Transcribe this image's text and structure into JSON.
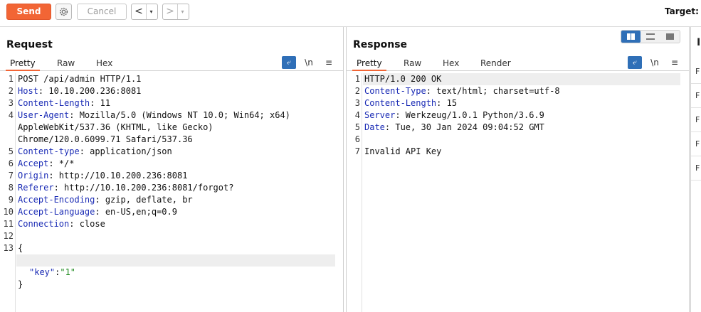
{
  "toolbar": {
    "send_label": "Send",
    "cancel_label": "Cancel",
    "back_arrow": "<",
    "forward_arrow": ">",
    "dropdown_glyph": "▾",
    "target_label": "Target: h"
  },
  "request": {
    "title": "Request",
    "tabs": [
      "Pretty",
      "Raw",
      "Hex"
    ],
    "active_tab": "Pretty",
    "tools": [
      "wrap-toggle",
      "\\n",
      "≡"
    ],
    "lines": [
      {
        "n": "1",
        "key": "",
        "val": "POST /api/admin HTTP/1.1"
      },
      {
        "n": "2",
        "key": "Host",
        "val": ": 10.10.200.236:8081"
      },
      {
        "n": "3",
        "key": "Content-Length",
        "val": ": 11"
      },
      {
        "n": "4",
        "key": "User-Agent",
        "val": ": Mozilla/5.0 (Windows NT 10.0; Win64; x64)"
      },
      {
        "n": "",
        "key": "",
        "val": "AppleWebKit/537.36 (KHTML, like Gecko)"
      },
      {
        "n": "",
        "key": "",
        "val": "Chrome/120.0.6099.71 Safari/537.36"
      },
      {
        "n": "5",
        "key": "Content-type",
        "val": ": application/json"
      },
      {
        "n": "6",
        "key": "Accept",
        "val": ": */*"
      },
      {
        "n": "7",
        "key": "Origin",
        "val": ": http://10.10.200.236:8081"
      },
      {
        "n": "8",
        "key": "Referer",
        "val": ": http://10.10.200.236:8081/forgot?"
      },
      {
        "n": "9",
        "key": "Accept-Encoding",
        "val": ": gzip, deflate, br"
      },
      {
        "n": "10",
        "key": "Accept-Language",
        "val": ": en-US,en;q=0.9"
      },
      {
        "n": "11",
        "key": "Connection",
        "val": ": close"
      },
      {
        "n": "12",
        "key": "",
        "val": ""
      },
      {
        "n": "13",
        "key": "",
        "val": "{"
      }
    ],
    "body_key": "\"key\"",
    "body_colon": ":",
    "body_value": "\"1\"",
    "body_close": "}"
  },
  "response": {
    "title": "Response",
    "tabs": [
      "Pretty",
      "Raw",
      "Hex",
      "Render"
    ],
    "active_tab": "Pretty",
    "lines": [
      {
        "n": "1",
        "key": "",
        "val": "HTTP/1.0 200 OK"
      },
      {
        "n": "2",
        "key": "Content-Type",
        "val": ": text/html; charset=utf-8"
      },
      {
        "n": "3",
        "key": "Content-Length",
        "val": ": 15"
      },
      {
        "n": "4",
        "key": "Server",
        "val": ": Werkzeug/1.0.1 Python/3.6.9"
      },
      {
        "n": "5",
        "key": "Date",
        "val": ": Tue, 30 Jan 2024 09:04:52 GMT"
      },
      {
        "n": "6",
        "key": "",
        "val": ""
      },
      {
        "n": "7",
        "key": "",
        "val": "Invalid API Key"
      }
    ]
  },
  "side": {
    "title_initial": "I",
    "row_initials": [
      "F",
      "F",
      "F",
      "F",
      "F"
    ]
  },
  "colors": {
    "accent": "#f26535",
    "header_key": "#1a2bb5",
    "string": "#1e8a1e",
    "toggle": "#2f6fb7"
  }
}
